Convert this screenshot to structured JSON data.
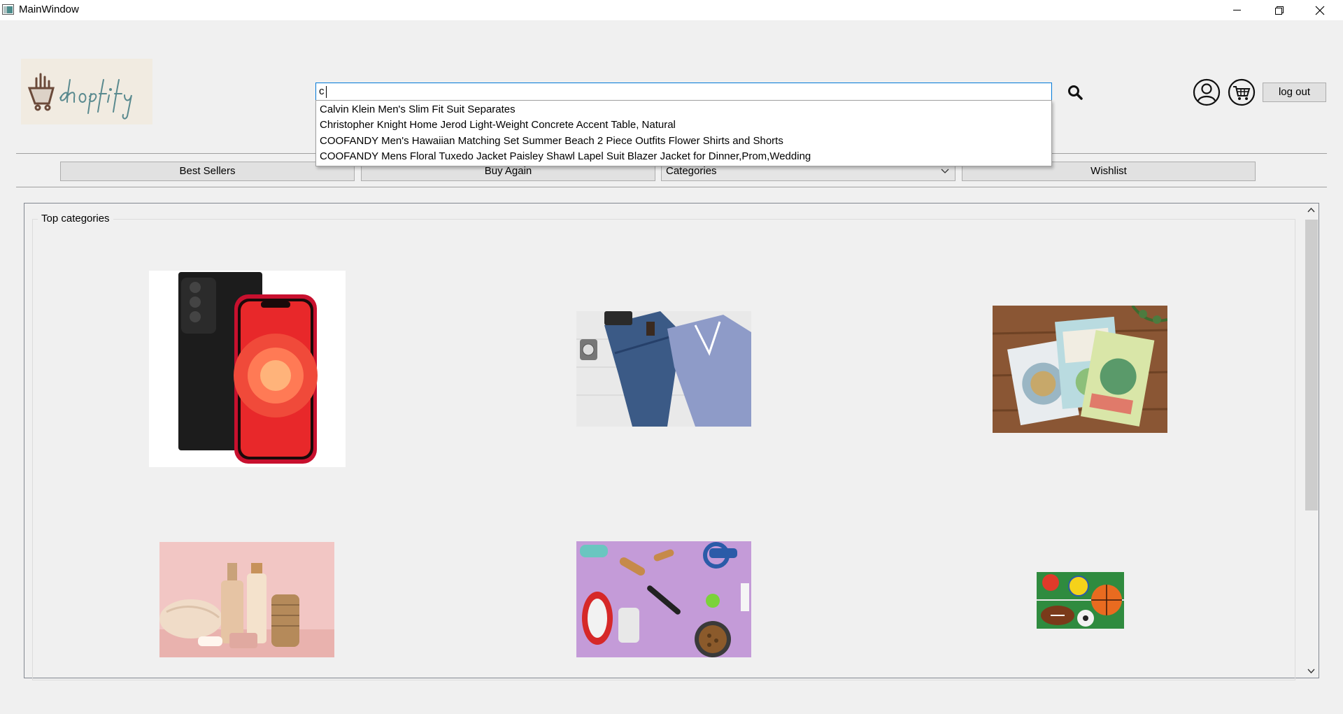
{
  "window": {
    "title": "MainWindow"
  },
  "search": {
    "value": "c"
  },
  "suggestions": [
    "Calvin Klein Men's Slim Fit Suit Separates",
    "Christopher Knight Home Jerod Light-Weight Concrete Accent Table, Natural",
    "COOFANDY Men's Hawaiian Matching Set Summer Beach 2 Piece Outfits Flower Shirts and Shorts",
    "COOFANDY Mens Floral Tuxedo Jacket Paisley Shawl Lapel Suit Blazer Jacket for Dinner,Prom,Wedding"
  ],
  "header": {
    "logout_label": "log out"
  },
  "nav": {
    "best_sellers": "Best Sellers",
    "buy_again": "Buy Again",
    "categories": "Categories",
    "wishlist": "Wishlist"
  },
  "main": {
    "group_title": "Top categories"
  },
  "categories": [
    {
      "icon": "smartphone-image"
    },
    {
      "icon": "clothing-image"
    },
    {
      "icon": "books-image"
    },
    {
      "icon": "beauty-products-image"
    },
    {
      "icon": "pet-supplies-image"
    },
    {
      "icon": "sports-balls-image"
    }
  ],
  "colors": {
    "accent": "#0078d7",
    "logo_bg": "#f1ebe1",
    "logo_text": "#5a8a8f"
  }
}
